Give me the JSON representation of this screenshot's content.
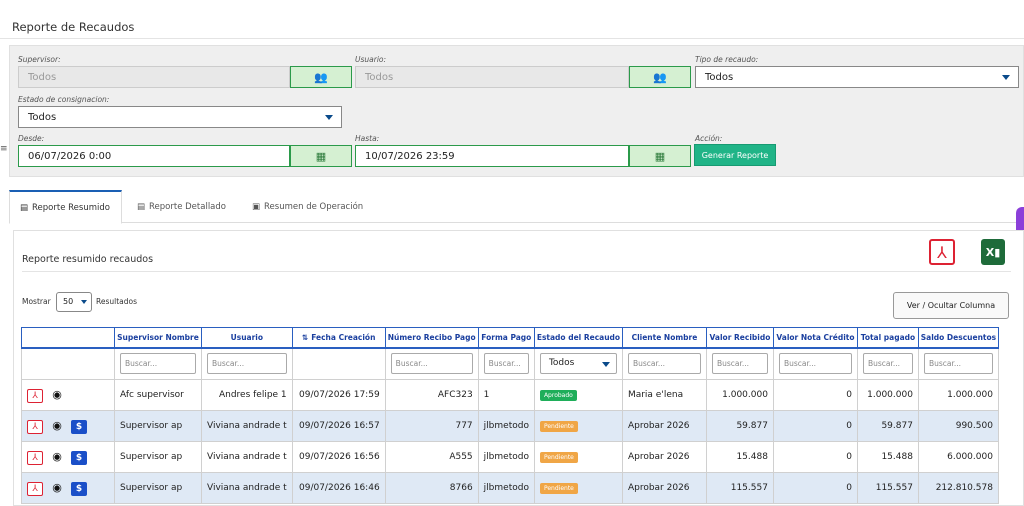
{
  "page_title": "Reporte de Recaudos",
  "filters": {
    "supervisor": {
      "label": "Supervisor:",
      "value": "Todos"
    },
    "usuario": {
      "label": "Usuario:",
      "value": "Todos"
    },
    "tipo_recaudo": {
      "label": "Tipo de recaudo:",
      "value": "Todos"
    },
    "estado_consignacion": {
      "label": "Estado de consignacion:",
      "value": "Todos"
    },
    "desde": {
      "label": "Desde:",
      "value": "06/07/2026 0:00"
    },
    "hasta": {
      "label": "Hasta:",
      "value": "10/07/2026 23:59"
    },
    "accion": {
      "label": "Acción:",
      "button": "Generar Reporte"
    }
  },
  "tabs": [
    {
      "label": "Reporte Resumido",
      "icon": "table-icon",
      "active": true
    },
    {
      "label": "Reporte Detallado",
      "icon": "list-icon",
      "active": false
    },
    {
      "label": "Resumen de Operación",
      "icon": "money-icon",
      "active": false
    }
  ],
  "panel": {
    "title": "Reporte resumido recaudos",
    "show_label": "Mostrar",
    "page_size": "50",
    "results_label": "Resultados",
    "column_toggle": "Ver / Ocultar Columna"
  },
  "table": {
    "headers": [
      "",
      "Supervisor Nombre",
      "Usuario",
      "Fecha Creación",
      "Número Recibo Pago",
      "Forma Pago",
      "Estado del Recaudo",
      "Cliente Nombre",
      "Valor Recibido",
      "Valor Nota Crédito",
      "Total pagado",
      "Saldo Descuentos"
    ],
    "search_placeholder": "Buscar...",
    "estado_filter": "Todos",
    "rows": [
      {
        "supervisor": "Afc supervisor",
        "usuario": "Andres felipe 1",
        "fecha": "09/07/2026 17:59",
        "recibo": "AFC323",
        "forma": "1",
        "estado": "Aprobado",
        "estado_color": "green",
        "cliente": "Maria e'lena",
        "valor": "1.000.000",
        "nota": "0",
        "total": "1.000.000",
        "saldo": "1.000.000",
        "dollar": false
      },
      {
        "supervisor": "Supervisor ap",
        "usuario": "Viviana andrade t",
        "fecha": "09/07/2026 16:57",
        "recibo": "777",
        "forma": "jlbmetodo",
        "estado": "Pendiente",
        "estado_color": "orange",
        "cliente": "Aprobar 2026",
        "valor": "59.877",
        "nota": "0",
        "total": "59.877",
        "saldo": "990.500",
        "dollar": true
      },
      {
        "supervisor": "Supervisor ap",
        "usuario": "Viviana andrade t",
        "fecha": "09/07/2026 16:56",
        "recibo": "A555",
        "forma": "jlbmetodo",
        "estado": "Pendiente",
        "estado_color": "orange",
        "cliente": "Aprobar 2026",
        "valor": "15.488",
        "nota": "0",
        "total": "15.488",
        "saldo": "6.000.000",
        "dollar": true
      },
      {
        "supervisor": "Supervisor ap",
        "usuario": "Viviana andrade t",
        "fecha": "09/07/2026 16:46",
        "recibo": "8766",
        "forma": "jlbmetodo",
        "estado": "Pendiente",
        "estado_color": "orange",
        "cliente": "Aprobar 2026",
        "valor": "115.557",
        "nota": "0",
        "total": "115.557",
        "saldo": "212.810.578",
        "dollar": true
      }
    ]
  },
  "colors": {
    "accent": "#20b487",
    "header_blue": "#1a3f9f",
    "row_alt": "#dfe9f5"
  }
}
